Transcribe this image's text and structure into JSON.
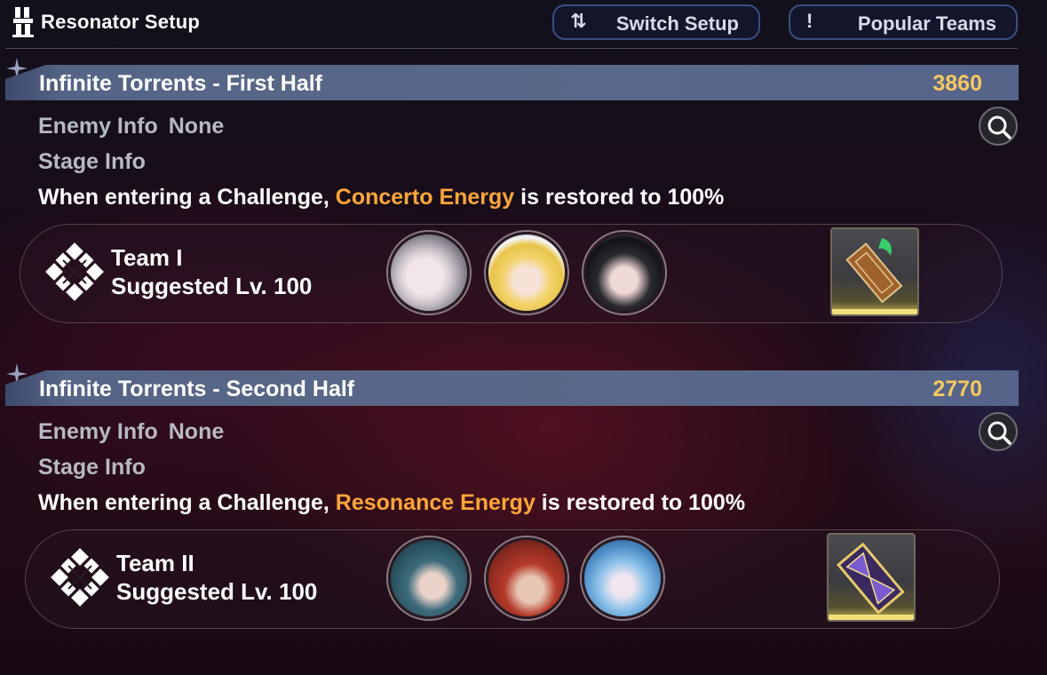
{
  "header": {
    "title": "Resonator Setup",
    "switch_label": "Switch Setup",
    "switch_icon": "swap-arrows-icon",
    "popular_label": "Popular Teams",
    "popular_icon": "exclamation-icon"
  },
  "sections": [
    {
      "title": "Infinite Torrents - First Half",
      "score": "3860",
      "enemy_label": "Enemy Info",
      "enemy_value": "None",
      "stage_label": "Stage Info",
      "effect_pre": "When entering a Challenge, ",
      "effect_highlight": "Concerto Energy",
      "effect_post": " is restored to 100%",
      "team": {
        "name": "Team I",
        "level": "Suggested Lv. 100",
        "members": [
          "white-hair-resonator-portrait",
          "blonde-hat-resonator-portrait",
          "black-hair-resonator-portrait"
        ],
        "item": "wooden-tablet-item-icon"
      }
    },
    {
      "title": "Infinite Torrents - Second Half",
      "score": "2770",
      "enemy_label": "Enemy Info",
      "enemy_value": "None",
      "stage_label": "Stage Info",
      "effect_pre": "When entering a Challenge, ",
      "effect_highlight": "Resonance Energy",
      "effect_post": " is restored to 100%",
      "team": {
        "name": "Team II",
        "level": "Suggested Lv. 100",
        "members": [
          "teal-hair-resonator-portrait",
          "red-hair-glasses-resonator-portrait",
          "light-blue-hair-resonator-portrait"
        ],
        "item": "hourglass-item-icon"
      }
    }
  ],
  "colors": {
    "score": "#f6c85f",
    "highlight": "#ffa63a",
    "banner": "#566485"
  }
}
